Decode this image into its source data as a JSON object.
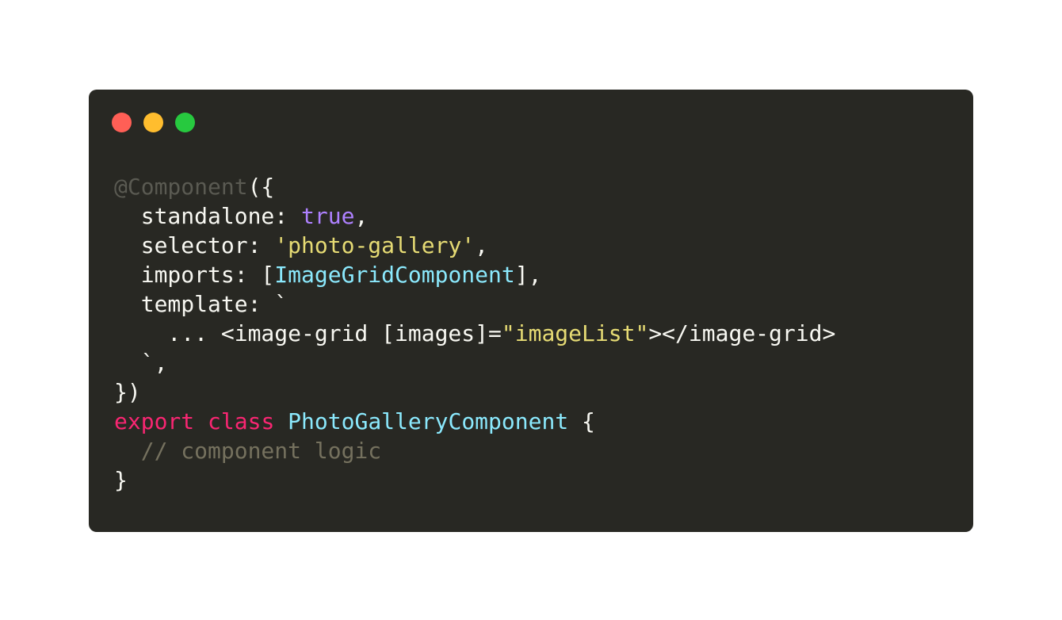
{
  "colors": {
    "window_bg": "#282823",
    "page_bg": "#ffffff",
    "dot_close": "#ff5f56",
    "dot_minimize": "#ffbd2e",
    "dot_maximize": "#27c93f",
    "plain": "#f8f8f2",
    "decorator": "#5a5a52",
    "keyword": "#f92672",
    "boolean": "#ae81ff",
    "string": "#e6db74",
    "class_name": "#8be9fd",
    "comment": "#75715e"
  },
  "window_controls": [
    {
      "name": "close-dot",
      "color": "#ff5f56"
    },
    {
      "name": "minimize-dot",
      "color": "#ffbd2e"
    },
    {
      "name": "maximize-dot",
      "color": "#27c93f"
    }
  ],
  "code_lines": [
    [
      {
        "text": "@Component",
        "type": "decorator"
      },
      {
        "text": "({",
        "type": "plain"
      }
    ],
    [
      {
        "text": "  standalone: ",
        "type": "plain"
      },
      {
        "text": "true",
        "type": "boolean"
      },
      {
        "text": ",",
        "type": "plain"
      }
    ],
    [
      {
        "text": "  selector: ",
        "type": "plain"
      },
      {
        "text": "'photo-gallery'",
        "type": "string"
      },
      {
        "text": ",",
        "type": "plain"
      }
    ],
    [
      {
        "text": "  imports: [",
        "type": "plain"
      },
      {
        "text": "ImageGridComponent",
        "type": "class_name"
      },
      {
        "text": "],",
        "type": "plain"
      }
    ],
    [
      {
        "text": "  template: `",
        "type": "plain"
      }
    ],
    [
      {
        "text": "    ... <image-grid [images]=",
        "type": "plain"
      },
      {
        "text": "\"imageList\"",
        "type": "string"
      },
      {
        "text": "></image-grid>",
        "type": "plain"
      }
    ],
    [
      {
        "text": "  `,",
        "type": "plain"
      }
    ],
    [
      {
        "text": "})",
        "type": "plain"
      }
    ],
    [
      {
        "text": "export",
        "type": "keyword"
      },
      {
        "text": " ",
        "type": "plain"
      },
      {
        "text": "class",
        "type": "keyword"
      },
      {
        "text": " ",
        "type": "plain"
      },
      {
        "text": "PhotoGalleryComponent",
        "type": "class_name"
      },
      {
        "text": " {",
        "type": "plain"
      }
    ],
    [
      {
        "text": "  // component logic",
        "type": "comment"
      }
    ],
    [
      {
        "text": "}",
        "type": "plain"
      }
    ]
  ]
}
